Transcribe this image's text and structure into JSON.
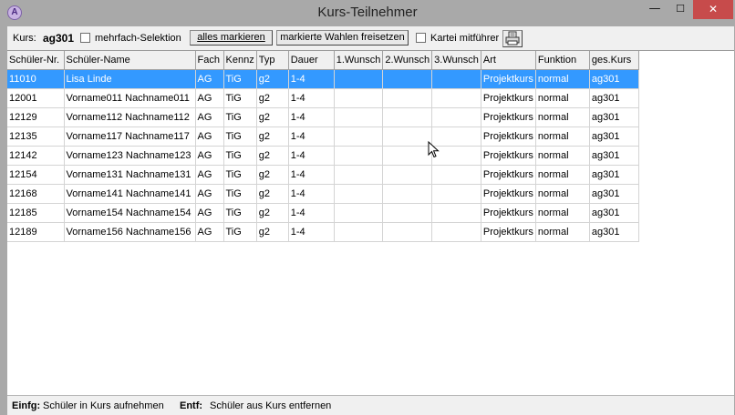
{
  "window": {
    "title": "Kurs-Teilnehmer",
    "app_icon": "A",
    "controls": [
      "minimize-icon",
      "maximize-icon",
      "close-icon"
    ]
  },
  "toolbar": {
    "kurs_label": "Kurs:",
    "kurs_value": "ag301",
    "multi_selection_label": "mehrfach-Selektion",
    "multi_selection_checked": false,
    "mark_all_label": "alles markieren",
    "release_marked_label": "markierte Wahlen freisetzen",
    "kartei_label": "Kartei mitführer",
    "kartei_checked": false,
    "print_icon": "printer-icon"
  },
  "table": {
    "columns": [
      "Schüler-Nr.",
      "Schüler-Name",
      "Fach",
      "Kennz",
      "Typ",
      "Dauer",
      "1.Wunsch",
      "2.Wunsch",
      "3.Wunsch",
      "Art",
      "Funktion",
      "ges.Kurs"
    ],
    "rows": [
      [
        "11010",
        "Lisa Linde",
        "AG",
        "TiG",
        "g2",
        "1-4",
        "",
        "",
        "",
        "Projektkurs",
        "normal",
        "ag301"
      ],
      [
        "12001",
        "Vorname011 Nachname011",
        "AG",
        "TiG",
        "g2",
        "1-4",
        "",
        "",
        "",
        "Projektkurs",
        "normal",
        "ag301"
      ],
      [
        "12129",
        "Vorname112 Nachname112",
        "AG",
        "TiG",
        "g2",
        "1-4",
        "",
        "",
        "",
        "Projektkurs",
        "normal",
        "ag301"
      ],
      [
        "12135",
        "Vorname117 Nachname117",
        "AG",
        "TiG",
        "g2",
        "1-4",
        "",
        "",
        "",
        "Projektkurs",
        "normal",
        "ag301"
      ],
      [
        "12142",
        "Vorname123 Nachname123",
        "AG",
        "TiG",
        "g2",
        "1-4",
        "",
        "",
        "",
        "Projektkurs",
        "normal",
        "ag301"
      ],
      [
        "12154",
        "Vorname131 Nachname131",
        "AG",
        "TiG",
        "g2",
        "1-4",
        "",
        "",
        "",
        "Projektkurs",
        "normal",
        "ag301"
      ],
      [
        "12168",
        "Vorname141 Nachname141",
        "AG",
        "TiG",
        "g2",
        "1-4",
        "",
        "",
        "",
        "Projektkurs",
        "normal",
        "ag301"
      ],
      [
        "12185",
        "Vorname154 Nachname154",
        "AG",
        "TiG",
        "g2",
        "1-4",
        "",
        "",
        "",
        "Projektkurs",
        "normal",
        "ag301"
      ],
      [
        "12189",
        "Vorname156 Nachname156",
        "AG",
        "TiG",
        "g2",
        "1-4",
        "",
        "",
        "",
        "Projektkurs",
        "normal",
        "ag301"
      ]
    ],
    "selected_row": 0
  },
  "status": {
    "key1": "Einfg:",
    "text1": "Schüler in Kurs aufnehmen",
    "key2": "Entf:",
    "text2": "Schüler aus Kurs entfernen"
  },
  "colors": {
    "selection": "#3399ff",
    "window_frame": "#a9a9a9",
    "close_button": "#c74b4b"
  }
}
